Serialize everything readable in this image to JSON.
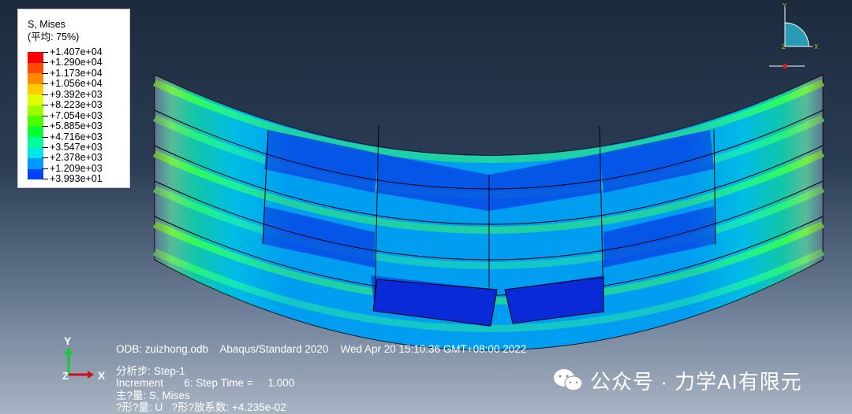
{
  "legend": {
    "title": "S, Mises",
    "subtitle": "(平均: 75%)",
    "levels": [
      {
        "label": "+1.407e+04",
        "color": "#ff0000"
      },
      {
        "label": "+1.290e+04",
        "color": "#ff4a00"
      },
      {
        "label": "+1.173e+04",
        "color": "#ff8c00"
      },
      {
        "label": "+1.056e+04",
        "color": "#ffcc00"
      },
      {
        "label": "+9.392e+03",
        "color": "#e0ff00"
      },
      {
        "label": "+8.223e+03",
        "color": "#9cff00"
      },
      {
        "label": "+7.054e+03",
        "color": "#4dff00"
      },
      {
        "label": "+5.885e+03",
        "color": "#00ff33"
      },
      {
        "label": "+4.716e+03",
        "color": "#00ff99"
      },
      {
        "label": "+3.547e+03",
        "color": "#00e5e5"
      },
      {
        "label": "+2.378e+03",
        "color": "#0099ff"
      },
      {
        "label": "+1.209e+03",
        "color": "#0040ff"
      },
      {
        "label": "+3.993e+01",
        "color": "#0000ff"
      }
    ]
  },
  "triad_top": {
    "y": "Y",
    "z": "Z",
    "x": "X"
  },
  "triad_bottom": {
    "y": "Y",
    "z": "Z",
    "x": "X"
  },
  "info": {
    "odb_line": "ODB: zuizhong.odb    Abaqus/Standard 2020    Wed Apr 20 15:10:36 GMT+08:00 2022",
    "step_line": "分析步: Step-1",
    "increment_line": "Increment       6: Step Time =     1.000",
    "primary_line": "主?量: S, Mises",
    "deformed_line": "?形?量: U   ?形?放系数: +4.235e-02"
  },
  "brand": {
    "text": "公众号 · 力学AI有限元",
    "icon": "wechat-icon"
  },
  "colors": {
    "accent_red": "#d42020",
    "triad_fill": "#2a9bb5",
    "mesh_blue": "#0a2ad8"
  }
}
